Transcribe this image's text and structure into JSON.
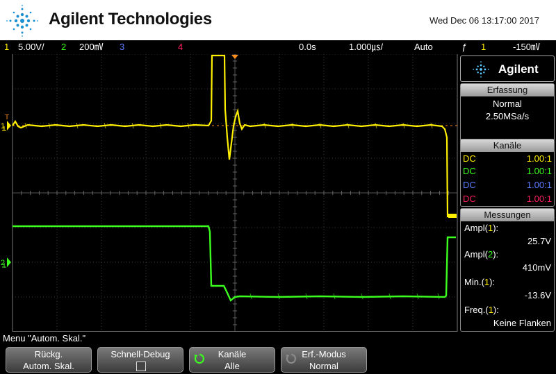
{
  "header": {
    "brand": "Agilent Technologies",
    "datetime": "Wed Dec 06 13:17:00 2017"
  },
  "statusbar": {
    "ch1_num": "1",
    "ch1_scale": "5.00V/",
    "ch2_num": "2",
    "ch2_scale": "200㎷",
    "ch3_num": "3",
    "ch4_num": "4",
    "time_offset": "0.0s",
    "time_scale": "1.000㎲/",
    "trigger_mode": "Auto",
    "trigger_slope": "ƒ",
    "trigger_source": "1",
    "trigger_level": "-150㎷"
  },
  "colors": {
    "ch1": "#ffef00",
    "ch2": "#3bff1e",
    "ch3": "#5c7cff",
    "ch4": "#ff2060",
    "trigger_marker": "#ff8c1a"
  },
  "scope": {
    "ch1_marker": "1",
    "ch2_marker": "2",
    "trigger_marker_label": "T"
  },
  "side_panel": {
    "brand": "Agilent",
    "acquisition": {
      "title": "Erfassung",
      "mode": "Normal",
      "rate": "2.50MSa/s"
    },
    "channels": {
      "title": "Kanäle",
      "rows": [
        {
          "coupling": "DC",
          "probe": "1.00:1"
        },
        {
          "coupling": "DC",
          "probe": "1.00:1"
        },
        {
          "coupling": "DC",
          "probe": "1.00:1"
        },
        {
          "coupling": "DC",
          "probe": "1.00:1"
        }
      ]
    },
    "measurements": {
      "title": "Messungen",
      "items": [
        {
          "name": "Ampl",
          "channel": "1",
          "value": "25.7V"
        },
        {
          "name": "Ampl",
          "channel": "2",
          "value": "410mV"
        },
        {
          "name": "Min.",
          "channel": "1",
          "value": "-13.6V"
        },
        {
          "name": "Freq.",
          "channel": "1",
          "value": "Keine Flanken"
        }
      ]
    }
  },
  "menu": {
    "title": "Menu \"Autom. Skal.\"",
    "softkeys": [
      {
        "line1": "Rückg.",
        "line2": "Autom. Skal."
      },
      {
        "line1": "Schnell-Debug",
        "line2": ""
      },
      {
        "line1": "Kanäle",
        "line2": "Alle"
      },
      {
        "line1": "Erf.-Modus",
        "line2": "Normal"
      }
    ]
  }
}
